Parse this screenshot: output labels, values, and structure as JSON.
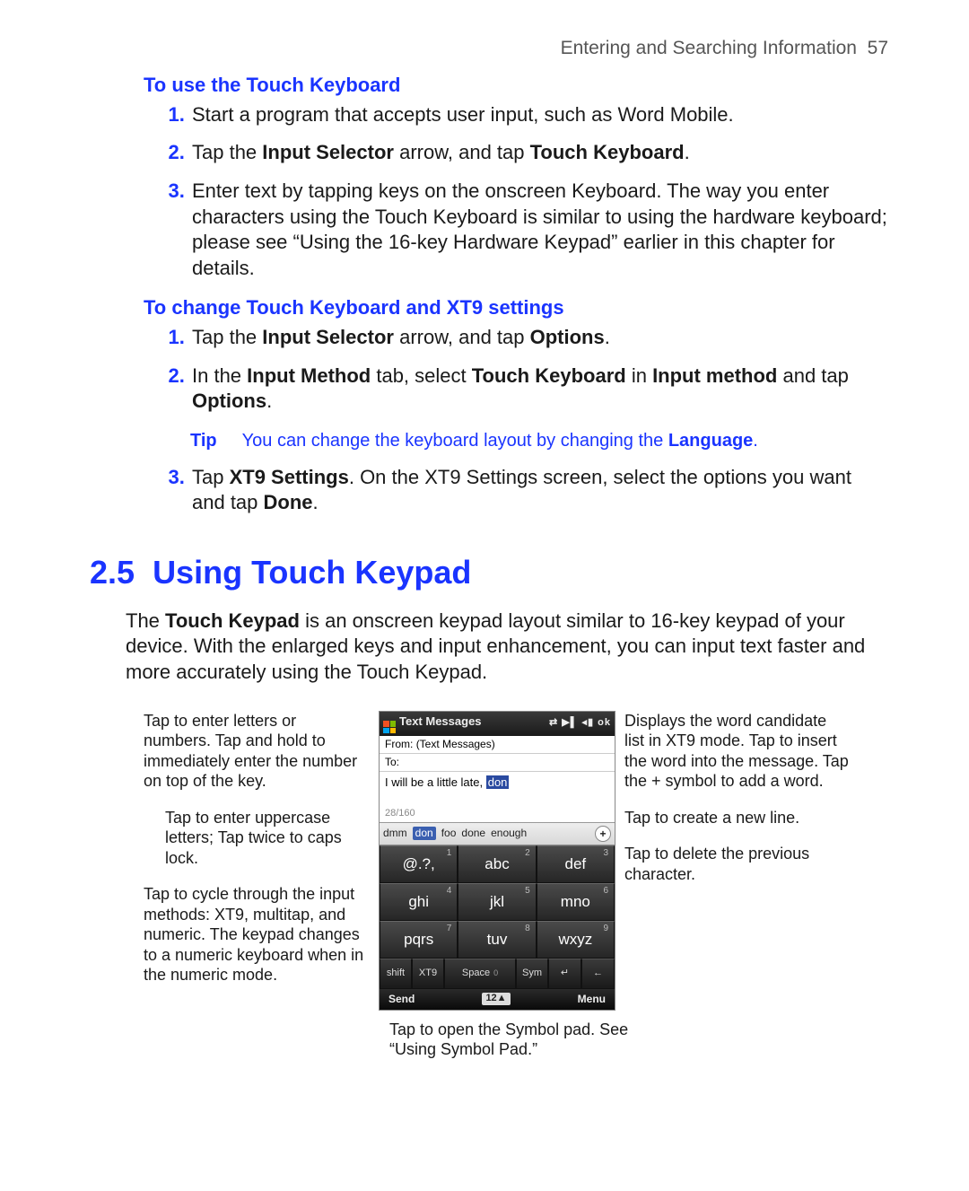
{
  "running_head": {
    "title": "Entering and Searching Information",
    "page": "57"
  },
  "sectA": {
    "heading": "To use the Touch Keyboard",
    "steps": [
      {
        "pre": "Start a program that accepts user input, such as Word Mobile."
      },
      {
        "pre": "Tap the ",
        "b1": "Input Selector",
        "mid": " arrow, and tap ",
        "b2": "Touch Keyboard",
        "post": "."
      },
      {
        "pre": "Enter text by tapping keys on the onscreen Keyboard. The way you enter characters using the Touch Keyboard is similar to using the hardware keyboard; please see “Using the 16-key Hardware Keypad” earlier in this chapter for details."
      }
    ]
  },
  "sectB": {
    "heading": "To change Touch Keyboard and XT9 settings",
    "steps": [
      {
        "pre": "Tap the ",
        "b1": "Input Selector",
        "mid": " arrow, and tap ",
        "b2": "Options",
        "post": "."
      },
      {
        "pre": "In the ",
        "b1": "Input Method",
        "mid": " tab, select ",
        "b2": "Touch Keyboard",
        "mid2": " in ",
        "b3": "Input method",
        "mid3": " and tap ",
        "b4": "Options",
        "post": "."
      },
      {
        "pre": "Tap ",
        "b1": "XT9 Settings",
        "mid": ". On the XT9 Settings screen, select the options you want and tap ",
        "b2": "Done",
        "post": "."
      }
    ],
    "tip_label": "Tip",
    "tip_text_pre": "You can change the keyboard layout by changing the ",
    "tip_bold": "Language",
    "tip_text_post": "."
  },
  "sectC": {
    "number": "2.5",
    "title": "Using Touch Keypad",
    "intro_pre": "The ",
    "intro_b": "Touch Keypad",
    "intro_post": " is an onscreen keypad layout similar to 16-key keypad of your device. With the enlarged keys and input enhancement, you can input text faster and more accurately using the Touch Keypad."
  },
  "callouts": {
    "left1": "Tap to enter letters or numbers. Tap and hold to immediately enter the number on top of the key.",
    "left2": "Tap to enter uppercase letters; Tap twice to caps lock.",
    "left3": "Tap to cycle through the input methods: XT9, multitap, and numeric. The keypad changes to a numeric keyboard when in the numeric mode.",
    "right1": "Displays the word candidate list in XT9 mode. Tap to insert the word into the message. Tap the + symbol to add a word.",
    "right2": "Tap to create a new line.",
    "right3": "Tap to delete the previous character.",
    "bottom": "Tap to open the Symbol pad. See “Using Symbol Pad.”"
  },
  "phone": {
    "title": "Text Messages",
    "status_icons": "⇄  ▶▌ ◂▮ ok",
    "from_label": "From:",
    "from_value": "(Text Messages)",
    "to_label": "To:",
    "body_pre": "I will be a little late, ",
    "body_sel": "don",
    "count": "28/160",
    "candidates": [
      "dmm",
      "don",
      "foo",
      "done",
      "enough"
    ],
    "selected_candidate_index": 1,
    "keys": [
      {
        "label": "@.?,",
        "num": "1"
      },
      {
        "label": "abc",
        "num": "2"
      },
      {
        "label": "def",
        "num": "3"
      },
      {
        "label": "ghi",
        "num": "4"
      },
      {
        "label": "jkl",
        "num": "5"
      },
      {
        "label": "mno",
        "num": "6"
      },
      {
        "label": "pqrs",
        "num": "7"
      },
      {
        "label": "tuv",
        "num": "8"
      },
      {
        "label": "wxyz",
        "num": "9"
      }
    ],
    "bottom_keys": [
      "shift",
      "XT9",
      "Space",
      "Sym",
      "↵",
      "←"
    ],
    "space_num": "0",
    "menu_left": "Send",
    "menu_right": "Menu",
    "sip": "12▲"
  }
}
